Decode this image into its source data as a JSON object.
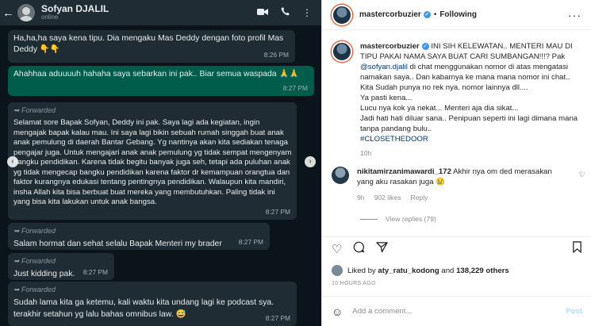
{
  "whatsapp": {
    "contact_name": "Sofyan DJALIL",
    "contact_status": "online",
    "icons": {
      "back": "arrow-left-icon",
      "video": "video-call-icon",
      "phone": "phone-icon",
      "menu": "more-vert-icon"
    },
    "messages": [
      {
        "type": "incoming",
        "forwarded": false,
        "text": "Ha,ha,ha saya kena tipu. Dia mengaku Mas Deddy dengan foto profil Mas Deddy 👇👇",
        "time": "8:26 PM"
      },
      {
        "type": "outgoing",
        "forwarded": false,
        "text": "Ahahhaa aduuuuh hahaha saya sebarkan ini pak.. Biar semua waspada 🙏🙏",
        "time": "8:27 PM"
      },
      {
        "type": "incoming",
        "forwarded": true,
        "forward_label": "Forwarded",
        "text": "Selamat sore Bapak Sofyan, Deddy ini pak. Saya lagi ada kegiatan, ingin mengajak bapak kalau mau. Ini saya lagi bikin sebuah rumah singgah buat anak anak pemulung di daerah Bantar Gebang. Yg nantinya akan kita sediakan tenaga pengajar juga. Untuk mengajari anak anak pemulung yg tidak sempat mengenyam bangku pendidikan. Karena tidak begitu banyak juga seh, tetapi ada puluhan anak yg tidak mengecap bangku pendidikan karena faktor dr kemampuan orangtua dan faktor kurangnya edukasi tentang pentingnya pendidikan. Walaupun kita mandiri, insha Allah kita bisa berbuat buat mereka yang membutuhkan. Paling tidak ini yang bisa kita lakukan untuk anak bangsa.",
        "time": "8:27 PM"
      },
      {
        "type": "incoming",
        "forwarded": true,
        "forward_label": "Forwarded",
        "text": "Salam hormat dan sehat selalu Bapak Menteri my brader",
        "time": "8:27 PM"
      },
      {
        "type": "incoming",
        "forwarded": true,
        "forward_label": "Forwarded",
        "text": "Just kidding pak.",
        "time": "8:27 PM"
      },
      {
        "type": "incoming",
        "forwarded": true,
        "forward_label": "Forwarded",
        "text": "Sudah lama kita ga ketemu, kali waktu kita undang lagi ke podcast sya. terakhir setahun yg lalu bahas omnibus law. 😅",
        "time": "8:27 PM"
      }
    ]
  },
  "instagram": {
    "username": "mastercorbuzier",
    "follow_state": "Following",
    "caption": {
      "username": "mastercorbuzier",
      "text_before_mention": "INI SIH KELEWATAN.. MENTERI MAU DI TIPU PAKAI NAMA SAYA BUAT CARI SUMBANGAN!!!? Pak ",
      "mention": "@sofyan.djalil",
      "text_after_mention": " di chat menggunakan nomor di atas mengatasi namakan saya.. Dan kabarnya ke mana mana nomor ini chat.. Kita Sudah punya no rek nya. nomor lainnya dll....",
      "line_2": "Ya pasti kena...",
      "line_3": "Lucu nya kok ya nekat... Menteri aja dia sikat...",
      "line_4": "Jadi hati hati diluar sana.. Penipuan seperti ini lagi dimana mana tanpa pandang bulu..",
      "hashtag": "#CLOSETHEDOOR",
      "age": "10h"
    },
    "comment": {
      "username": "nikitamirzanimawardi_172",
      "text": "Akhir nya om ded merasakan yang aku rasakan juga 😢",
      "age": "9h",
      "likes": "902 likes",
      "reply_label": "Reply",
      "view_replies": "View replies (79)"
    },
    "liked_by": {
      "prefix": "Liked by",
      "user": "aty_ratu_kodong",
      "middle": "and",
      "count": "138,229 others"
    },
    "posted_ago": "10 HOURS AGO",
    "add_comment_placeholder": "Add a comment...",
    "post_label": "Post",
    "icons": {
      "like": "heart-icon",
      "comment": "comment-icon",
      "share": "share-icon",
      "save": "bookmark-icon",
      "emoji": "emoji-icon",
      "more": "more-horiz-icon"
    }
  }
}
